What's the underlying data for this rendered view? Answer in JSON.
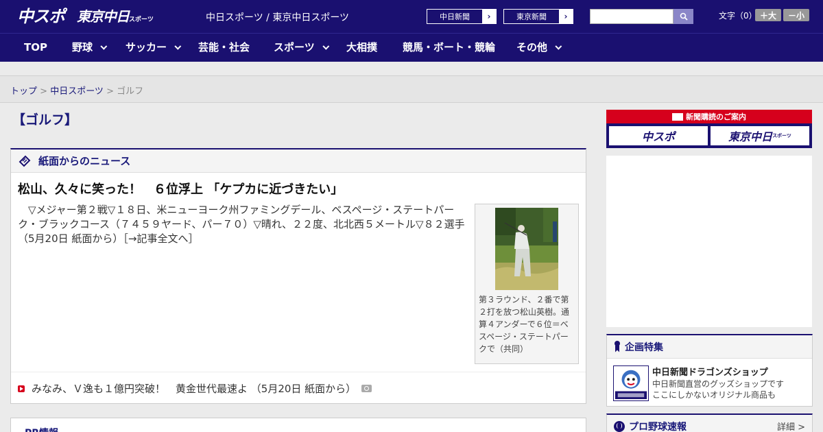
{
  "header": {
    "logo_main": "中スポ",
    "logo_tokyo": "東京中日",
    "logo_tokyo_small": "スポーツ",
    "site_links": "中日スポーツ / 東京中日スポーツ",
    "ext_chunichi": "中日新聞",
    "ext_tokyo": "東京新聞",
    "ext_arrow": "›",
    "search_placeholder": "",
    "font_label": "文字（0）",
    "font_big": "＋大",
    "font_small": "－小"
  },
  "nav": {
    "items": [
      {
        "label": "TOP",
        "dropdown": false
      },
      {
        "label": "野球",
        "dropdown": true
      },
      {
        "label": "サッカー",
        "dropdown": true
      },
      {
        "label": "芸能・社会",
        "dropdown": false
      },
      {
        "label": "スポーツ",
        "dropdown": true
      },
      {
        "label": "大相撲",
        "dropdown": false
      },
      {
        "label": "競馬・ボート・競輪",
        "dropdown": false
      },
      {
        "label": "その他",
        "dropdown": true
      }
    ]
  },
  "breadcrumb": {
    "home": "トップ",
    "sep1": " > ",
    "section": "中日スポーツ",
    "sep2": " > ",
    "current": "ゴルフ"
  },
  "page": {
    "title": "【ゴルフ】"
  },
  "news": {
    "section_title": "紙面からのニュース",
    "headline": "松山、久々に笑った！　６位浮上 「ケプカに近づきたい」",
    "body": "　▽メジャー第２戦▽１８日、米ニューヨーク州ファミングデール、ベスページ・ステートパーク・ブラックコース（７４５９ヤード、パー７０）▽晴れ、２２度、北北西５メートル▽８２選手（5月20日 紙面から）",
    "more_link": "［→記事全文へ］",
    "photo_caption": "第３ラウンド、２番で第２打を放つ松山英樹。通算４アンダーで６位＝ベスページ・ステートパークで（共同）",
    "sub_item": "みなみ、Ｖ逸も１億円突破！　黄金世代最速よ （5月20日 紙面から）"
  },
  "pr": {
    "title": "PR情報"
  },
  "sidebar": {
    "subscription_bar": "新聞購読のご案内",
    "tile_chuspo": "中スポ",
    "tile_tokyo": "東京中日",
    "tile_tokyo_small": "スポーツ",
    "feature_title": "企画特集",
    "feature_item_title": "中日新聞ドラゴンズショップ",
    "feature_item_desc1": "中日新聞直営のグッズショップです",
    "feature_item_desc2": "ここにしかないオリジナル商品も",
    "baseball_title": "プロ野球速報",
    "baseball_detail": "詳細 >"
  },
  "colors": {
    "brand_navy": "#1a1070",
    "accent_red": "#d6001c"
  }
}
